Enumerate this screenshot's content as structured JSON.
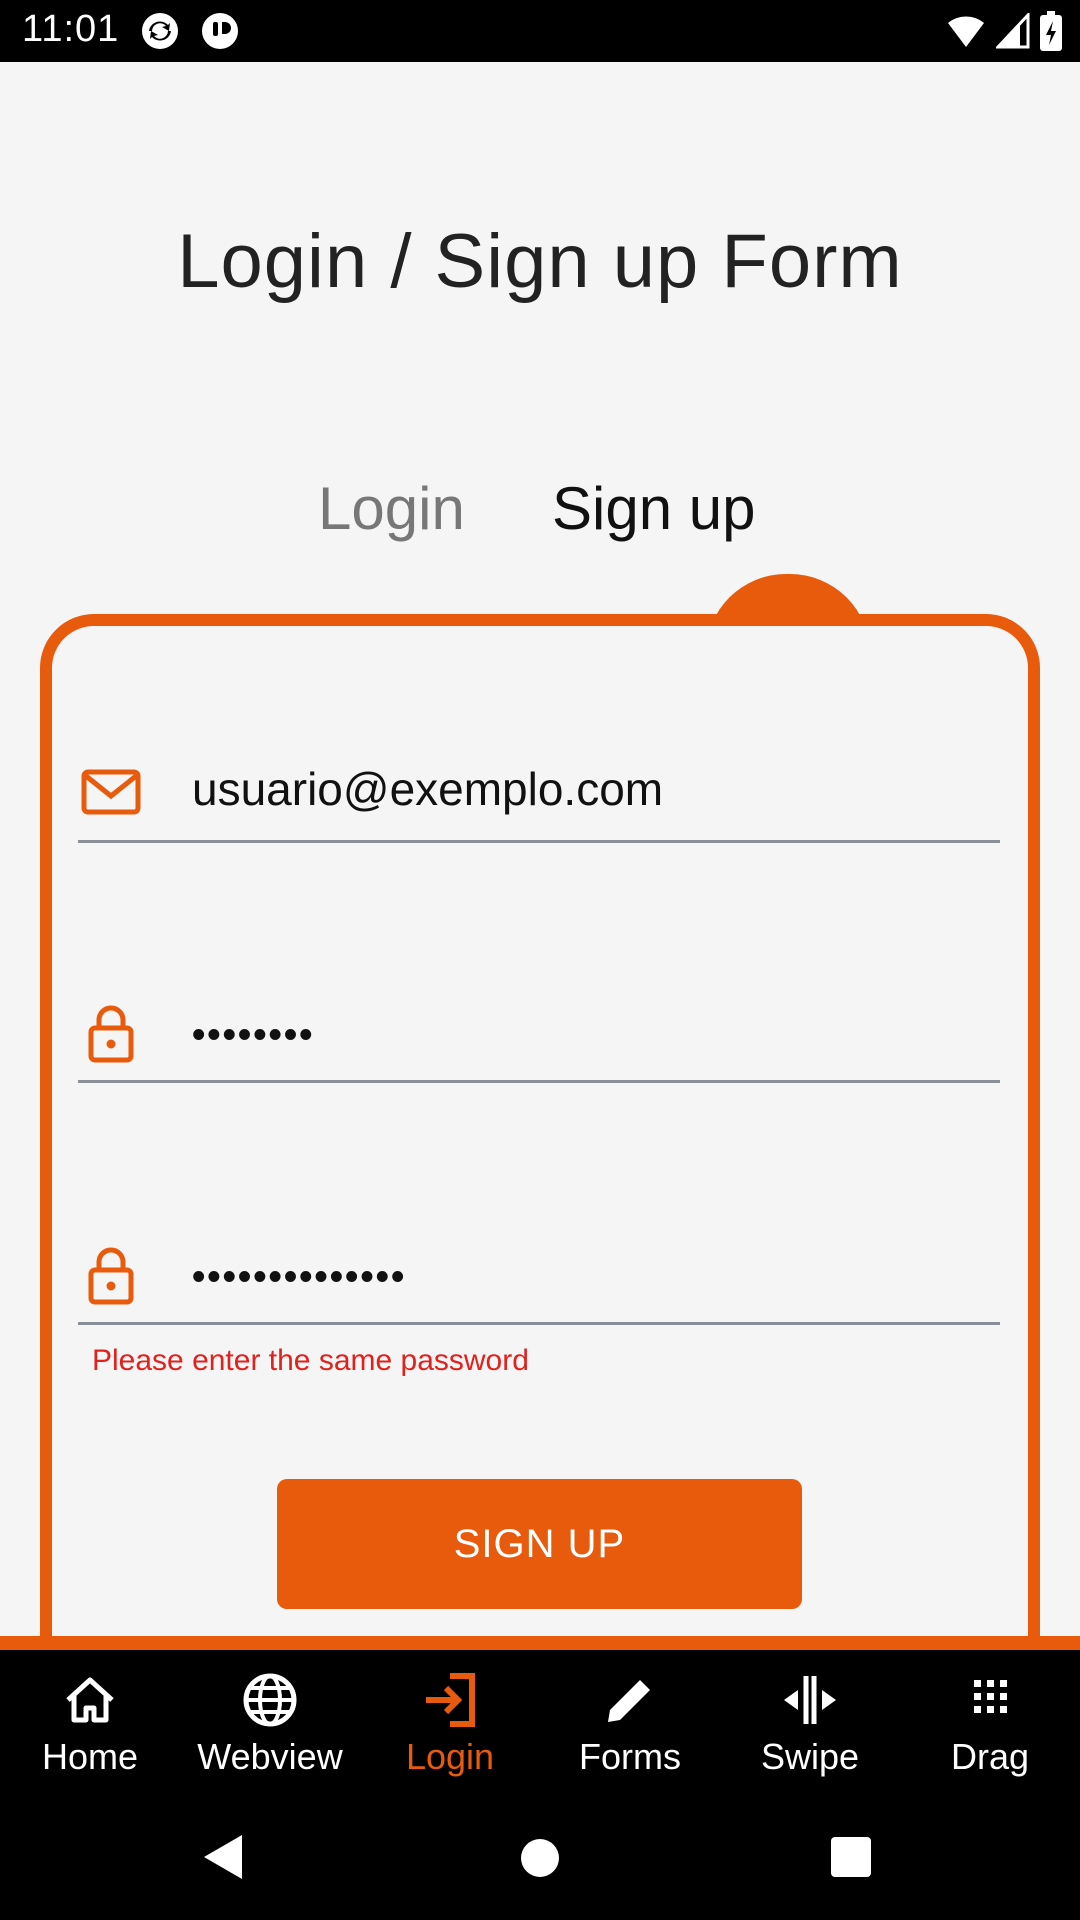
{
  "status_bar": {
    "time": "11:01"
  },
  "title": "Login / Sign up Form",
  "tabs": {
    "login": "Login",
    "signup": "Sign up",
    "active": "signup"
  },
  "form": {
    "email": {
      "value": "usuario@exemplo.com",
      "icon": "mail-icon"
    },
    "password": {
      "value": "••••••••",
      "icon": "lock-icon"
    },
    "confirm_password": {
      "value": "••••••••••••••",
      "icon": "lock-icon"
    },
    "error": "Please enter the same password",
    "submit_label": "SIGN UP"
  },
  "bottom_nav": [
    {
      "label": "Home",
      "icon": "home-icon"
    },
    {
      "label": "Webview",
      "icon": "globe-icon"
    },
    {
      "label": "Login",
      "icon": "login-icon",
      "active": true
    },
    {
      "label": "Forms",
      "icon": "pencil-icon"
    },
    {
      "label": "Swipe",
      "icon": "swipe-icon"
    },
    {
      "label": "Drag",
      "icon": "grid-icon"
    }
  ],
  "colors": {
    "accent": "#e85a0c",
    "error": "#e0221e",
    "background": "#f5f5f5"
  }
}
